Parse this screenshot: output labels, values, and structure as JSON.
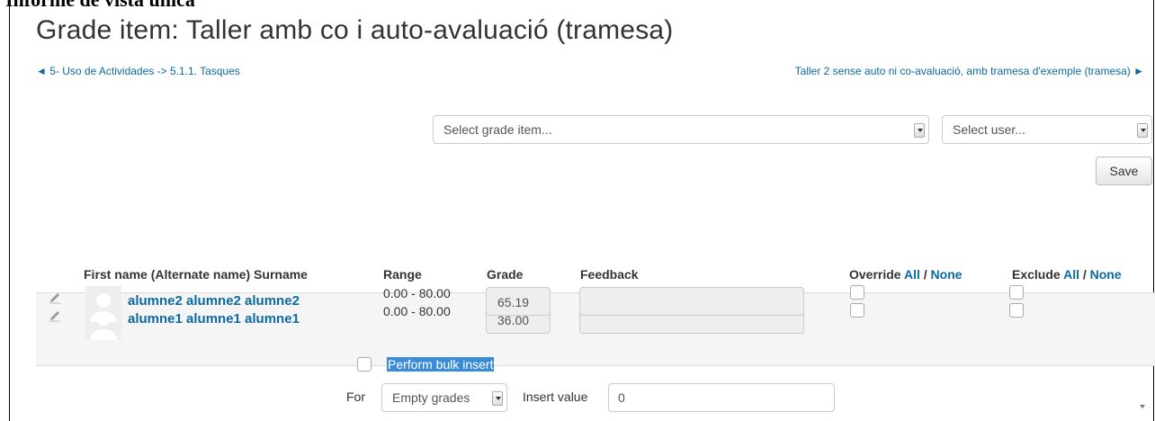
{
  "document_heading": "Informe de vista única",
  "page": {
    "title": "Grade item: Taller amb co i auto-avaluació (tramesa)",
    "nav_prev": "◄ 5- Uso de Actividades -> 5.1.1. Tasques",
    "nav_next": "Taller 2 sense auto ni co-avaluació, amb tramesa d'exemple (tramesa) ►"
  },
  "selectors": {
    "grade_item": "Select grade item...",
    "user": "Select user..."
  },
  "save_label": "Save",
  "table": {
    "headers": {
      "name": "First name (Alternate name) Surname",
      "range": "Range",
      "grade": "Grade",
      "feedback": "Feedback",
      "override": "Override",
      "exclude": "Exclude",
      "all": "All",
      "separator": " / ",
      "none": "None"
    },
    "rows": [
      {
        "name": "alumne1 alumne1 alumne1",
        "range": "0.00 - 80.00",
        "grade": "36.00",
        "feedback": "",
        "override": false,
        "exclude": false
      },
      {
        "name": "alumne2 alumne2 alumne2",
        "range": "0.00 - 80.00",
        "grade": "65.19",
        "feedback": "",
        "override": false,
        "exclude": false
      }
    ]
  },
  "bulk": {
    "label": "Perform bulk insert",
    "checked": false,
    "for_label": "For",
    "for_value": "Empty grades",
    "insert_label": "Insert value",
    "insert_value": "0"
  },
  "colors": {
    "link": "#0a6aa1",
    "selection": "#3b8cd7",
    "row_bg": "#f5f5f5"
  }
}
